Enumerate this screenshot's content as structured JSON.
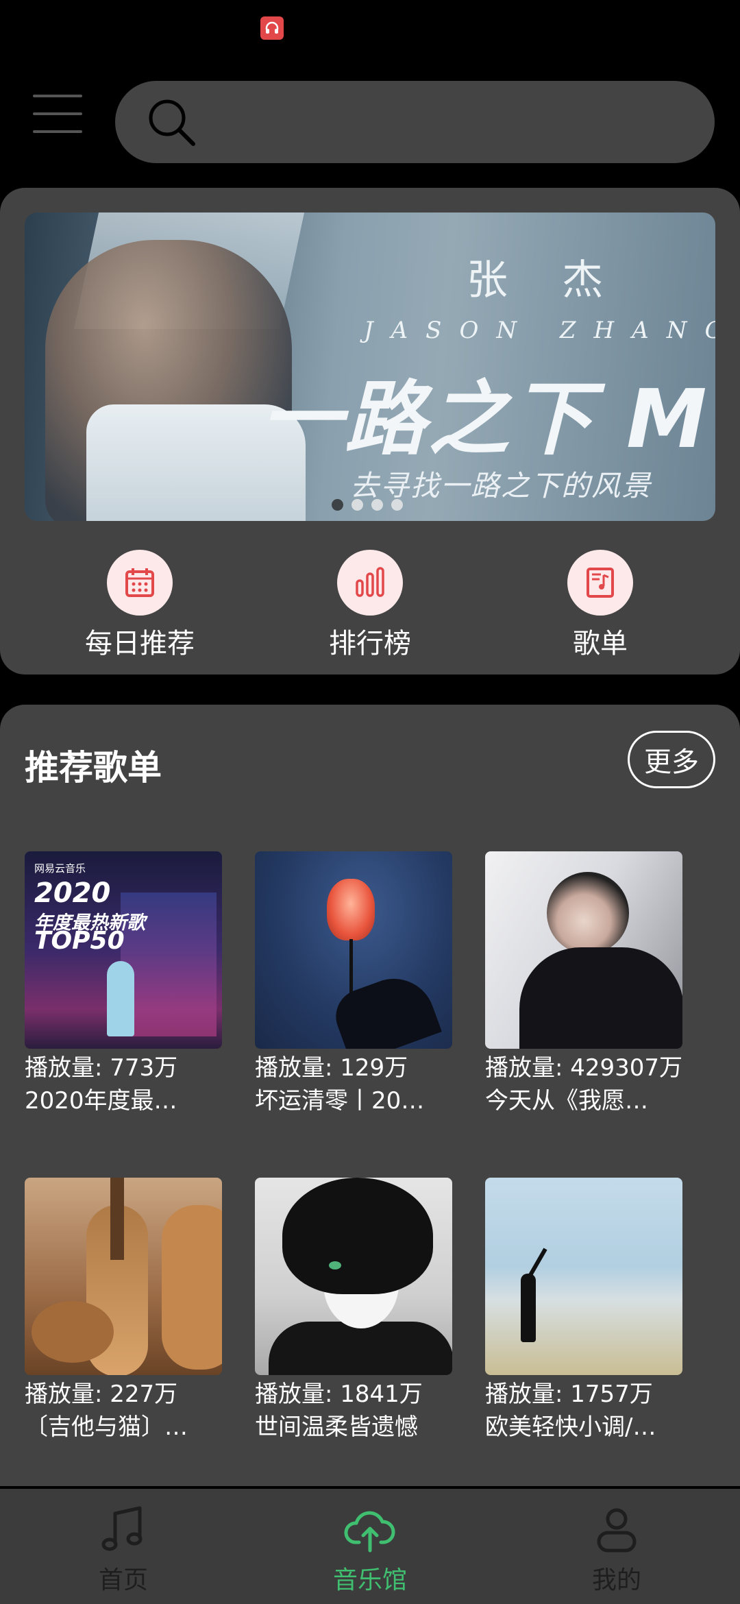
{
  "theme": {
    "accent": "#3fbf6f",
    "icon_red": "#e2474a",
    "card_bg": "#434343"
  },
  "header": {
    "menu_icon": "hamburger-menu-icon",
    "search": {
      "icon": "search-icon",
      "placeholder": "",
      "value": ""
    }
  },
  "banner": {
    "artist_cn": "张 杰",
    "artist_en": "JASON ZHANG",
    "title": "一路之下 M",
    "subtitle": "去寻找一路之下的风景",
    "page_count": 4,
    "active_page": 1
  },
  "quick_entries": [
    {
      "label": "每日推荐",
      "icon": "calendar-icon"
    },
    {
      "label": "排行榜",
      "icon": "bar-chart-icon"
    },
    {
      "label": "歌单",
      "icon": "playlist-icon"
    }
  ],
  "recommended": {
    "title": "推荐歌单",
    "more_label": "更多",
    "playlists": [
      {
        "plays": "播放量: 773万",
        "name": "2020年度最…",
        "cover": {
          "brand": "网易云音乐",
          "line1": "2020",
          "line2": "年度最热新歌",
          "line3": "TOP50"
        }
      },
      {
        "plays": "播放量: 129万",
        "name": "坏运清零丨20…"
      },
      {
        "plays": "播放量: 429307万",
        "name": "今天从《我愿…"
      },
      {
        "plays": "播放量: 227万",
        "name": "〔吉他与猫〕…"
      },
      {
        "plays": "播放量: 1841万",
        "name": "世间温柔皆遗憾"
      },
      {
        "plays": "播放量: 1757万",
        "name": "欧美轻快小调/…"
      }
    ]
  },
  "bottom_nav": {
    "items": [
      {
        "label": "首页",
        "icon": "music-note-icon",
        "active": false
      },
      {
        "label": "音乐馆",
        "icon": "cloud-upload-icon",
        "active": true
      },
      {
        "label": "我的",
        "icon": "user-icon",
        "active": false
      }
    ]
  }
}
